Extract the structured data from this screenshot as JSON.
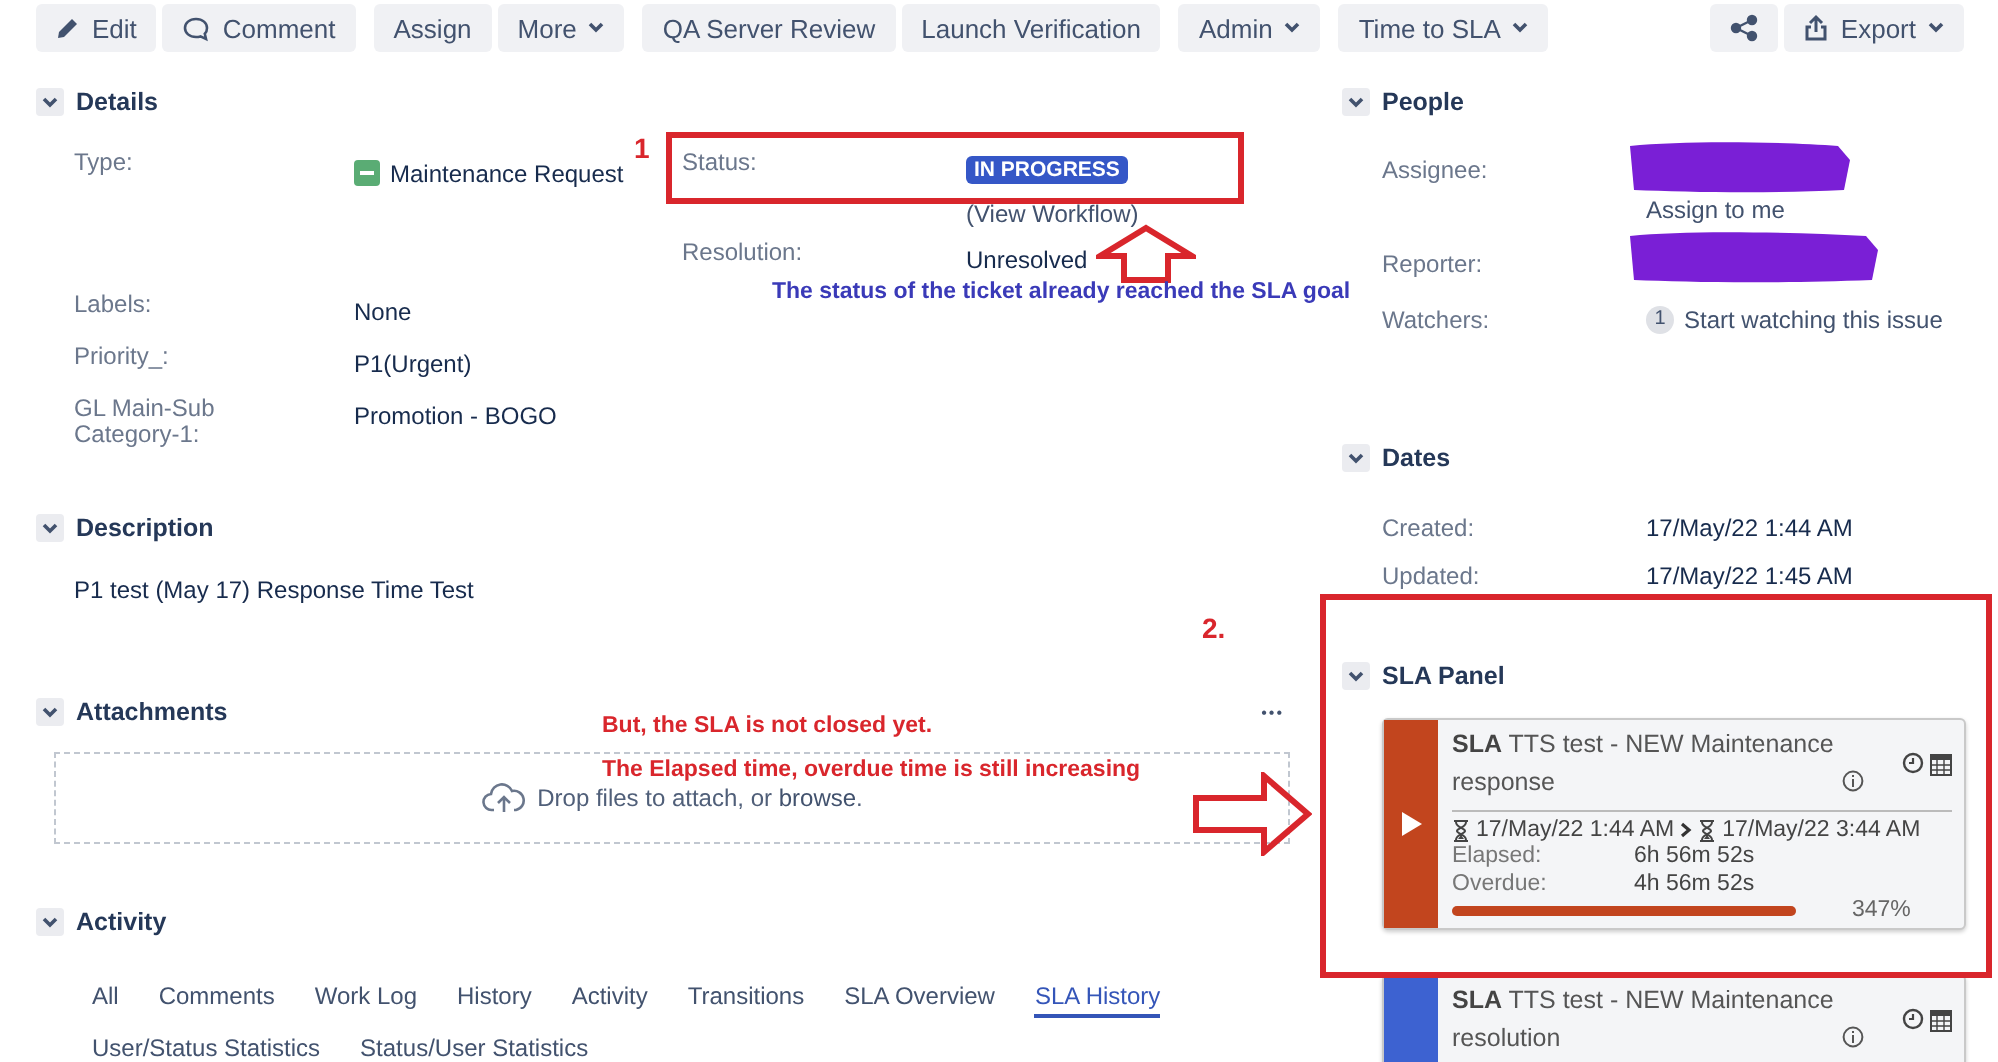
{
  "toolbar": {
    "groups": [
      [
        {
          "label": "Edit"
        },
        {
          "label": "Comment"
        }
      ],
      [
        {
          "label": "Assign"
        },
        {
          "label": "More",
          "dropdown": true
        }
      ],
      [
        {
          "label": "QA Server Review"
        },
        {
          "label": "Launch Verification"
        }
      ],
      [
        {
          "label": "Admin",
          "dropdown": true
        }
      ],
      [
        {
          "label": "Time to SLA",
          "dropdown": true
        }
      ]
    ],
    "right": [
      {
        "kind": "share"
      },
      {
        "label": "Export",
        "dropdown": true
      }
    ]
  },
  "details": {
    "title": "Details",
    "expanded": true,
    "type": {
      "label": "Type:",
      "value": "Maintenance Request"
    },
    "status": {
      "label": "Status:",
      "value": "IN PROGRESS",
      "link": "(View Workflow)"
    },
    "resolution": {
      "label": "Resolution:",
      "value": "Unresolved"
    },
    "fields": [
      {
        "label": "Labels:",
        "value": "None"
      },
      {
        "label": "Priority_:",
        "value": "P1(Urgent)"
      },
      {
        "label": "GL Main-Sub Category-1:",
        "value": "Promotion - BOGO"
      }
    ]
  },
  "description": {
    "title": "Description",
    "expanded": true,
    "text": "P1 test (May 17) Response Time Test"
  },
  "attachments": {
    "title": "Attachments",
    "expanded": true,
    "more": "•••",
    "drop_text": "Drop files to attach, or ",
    "browse": "browse",
    "drop_end": "."
  },
  "activity": {
    "title": "Activity",
    "expanded": true,
    "tabs": [
      {
        "label": "All",
        "selected": false
      },
      {
        "label": "Comments",
        "selected": false
      },
      {
        "label": "Work Log",
        "selected": false
      },
      {
        "label": "History",
        "selected": false
      },
      {
        "label": "Activity",
        "selected": false
      },
      {
        "label": "Transitions",
        "selected": false
      },
      {
        "label": "SLA Overview",
        "selected": false
      },
      {
        "label": "SLA History",
        "selected": true
      },
      {
        "label": "User/Status Statistics",
        "selected": false
      },
      {
        "label": "Status/User Statistics",
        "selected": false
      }
    ]
  },
  "people": {
    "title": "People",
    "expanded": true,
    "assignee": {
      "label": "Assignee:",
      "redacted": true,
      "action": "Assign to me"
    },
    "reporter": {
      "label": "Reporter:",
      "redacted": true
    },
    "watchers": {
      "label": "Watchers:",
      "count": "1",
      "action": "Start watching this issue"
    }
  },
  "dates": {
    "title": "Dates",
    "expanded": true,
    "rows": [
      {
        "label": "Created:",
        "value": "17/May/22 1:44 AM"
      },
      {
        "label": "Updated:",
        "value": "17/May/22 1:45 AM"
      }
    ]
  },
  "sla_panel": {
    "title": "SLA Panel",
    "expanded": true,
    "cards": [
      {
        "color": "#c2451e",
        "title": "**SLA** TTS test - NEW Maintenance response",
        "start": "17/May/22 1:44 AM",
        "end": "17/May/22 3:44 AM",
        "rows": [
          {
            "label": "Elapsed:",
            "value": "6h 56m 52s"
          },
          {
            "label": "Overdue:",
            "value": "4h 56m 52s"
          }
        ],
        "level": 1,
        "percent": "347%"
      },
      {
        "color": "#3d62d1",
        "title": "**SLA** TTS test - NEW Maintenance resolution"
      }
    ]
  },
  "annotations": [
    {
      "kind": "box",
      "color": "#d9262c"
    },
    {
      "kind": "number",
      "text": "1",
      "color": "#d9262c"
    },
    {
      "kind": "uparrow",
      "color": "#d9262c"
    },
    {
      "kind": "note",
      "text": "The status of the ticket already reached the SLA goal",
      "color": "#3a3ab8"
    },
    {
      "kind": "number",
      "text": "2.",
      "color": "#d9262c"
    },
    {
      "kind": "box",
      "color": "#d9262c"
    },
    {
      "kind": "note",
      "text": "But, the SLA is not closed yet.",
      "color": "#d9262c"
    },
    {
      "kind": "note",
      "text": "The Elapsed time, overdue time is still increasing",
      "color": "#d9262c"
    },
    {
      "kind": "rightarrow",
      "color": "#d9262c"
    }
  ]
}
